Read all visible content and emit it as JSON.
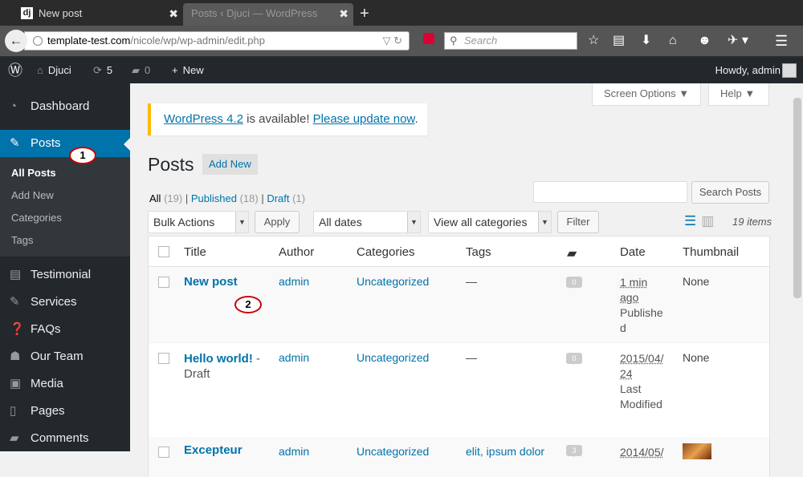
{
  "browser": {
    "tab1": {
      "favicon": "dj",
      "title": "New post",
      "close": "✖"
    },
    "tab2": {
      "title": "Posts ‹ Djuci — WordPress",
      "close": "✖"
    },
    "newtab": "+",
    "url_host": "template-test.com",
    "url_path": "/nicole/wp/wp-admin/edit.php",
    "search_placeholder": "Search",
    "toolbar_icons": [
      "star-icon",
      "reading-list-icon",
      "download-icon",
      "home-icon",
      "chat-icon",
      "tools-icon",
      "menu-icon"
    ]
  },
  "adminbar": {
    "site_name": "Djuci",
    "updates_count": "5",
    "comments_count": "0",
    "new_label": "New",
    "howdy": "Howdy, admin"
  },
  "sidebar": {
    "dashboard": "Dashboard",
    "posts": "Posts",
    "submenu": [
      "All Posts",
      "Add New",
      "Categories",
      "Tags"
    ],
    "items": [
      "Testimonial",
      "Services",
      "FAQs",
      "Our Team",
      "Media",
      "Pages",
      "Comments"
    ]
  },
  "callouts": {
    "one": "1",
    "two": "2"
  },
  "main": {
    "screen_options": "Screen Options ▼",
    "help": "Help ▼",
    "notice_link1": "WordPress 4.2",
    "notice_text": " is available! ",
    "notice_link2": "Please update now",
    "notice_end": ".",
    "page_title": "Posts",
    "add_new": "Add New",
    "views": {
      "all": "All",
      "all_count": "(19)",
      "published": "Published",
      "published_count": "(18)",
      "draft": "Draft",
      "draft_count": "(1)",
      "sep": "|"
    },
    "search_button": "Search Posts",
    "bulk_actions": "Bulk Actions",
    "apply": "Apply",
    "all_dates": "All dates",
    "all_categories": "View all categories",
    "filter": "Filter",
    "items_count": "19 items"
  },
  "table": {
    "headers": {
      "title": "Title",
      "author": "Author",
      "categories": "Categories",
      "tags": "Tags",
      "date": "Date",
      "thumbnail": "Thumbnail"
    },
    "rows": [
      {
        "title": "New post",
        "suffix": "",
        "author": "admin",
        "category": "Uncategorized",
        "tags": "—",
        "comments": "0",
        "date_line1": "1 min",
        "date_line2": "ago",
        "status1": "Publishe",
        "status2": "d",
        "thumbnail": "None"
      },
      {
        "title": "Hello world!",
        "suffix": " -",
        "suffix2": "Draft",
        "author": "admin",
        "category": "Uncategorized",
        "tags": "—",
        "comments": "0",
        "date_line1": "2015/04/",
        "date_line2": "24",
        "status1": "Last",
        "status2": "Modified",
        "thumbnail": "None"
      },
      {
        "title": "Excepteur",
        "author": "admin",
        "category": "Uncategorized",
        "tags": "elit, ipsum dolor",
        "comments": "3",
        "date_line1": "2014/05/"
      }
    ]
  }
}
